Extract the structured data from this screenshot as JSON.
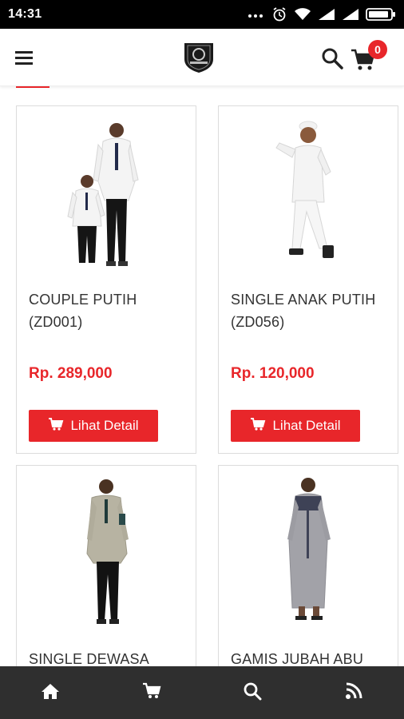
{
  "status_bar": {
    "time": "14:31"
  },
  "header": {
    "menu_icon": "hamburger-menu-icon",
    "logo_icon": "brand-shield-logo",
    "search_icon": "search-icon",
    "cart_icon": "shopping-cart-icon",
    "cart_count": "0"
  },
  "products": [
    {
      "title_line1": "COUPLE PUTIH",
      "title_line2": "(ZD001)",
      "price": "Rp. 289,000",
      "button_label": "Lihat Detail"
    },
    {
      "title_line1": "SINGLE ANAK PUTIH",
      "title_line2": "(ZD056)",
      "price": "Rp. 120,000",
      "button_label": "Lihat Detail"
    },
    {
      "title_line1": "SINGLE DEWASA",
      "title_line2": "",
      "price": "",
      "button_label": ""
    },
    {
      "title_line1": "GAMIS JUBAH ABU",
      "title_line2": "",
      "price": "",
      "button_label": ""
    }
  ],
  "bottom_nav": [
    {
      "icon": "home-icon"
    },
    {
      "icon": "cart-icon"
    },
    {
      "icon": "search-icon"
    },
    {
      "icon": "rss-icon"
    }
  ],
  "colors": {
    "accent": "#e8262a",
    "nav_bg": "#2f2f2f"
  }
}
